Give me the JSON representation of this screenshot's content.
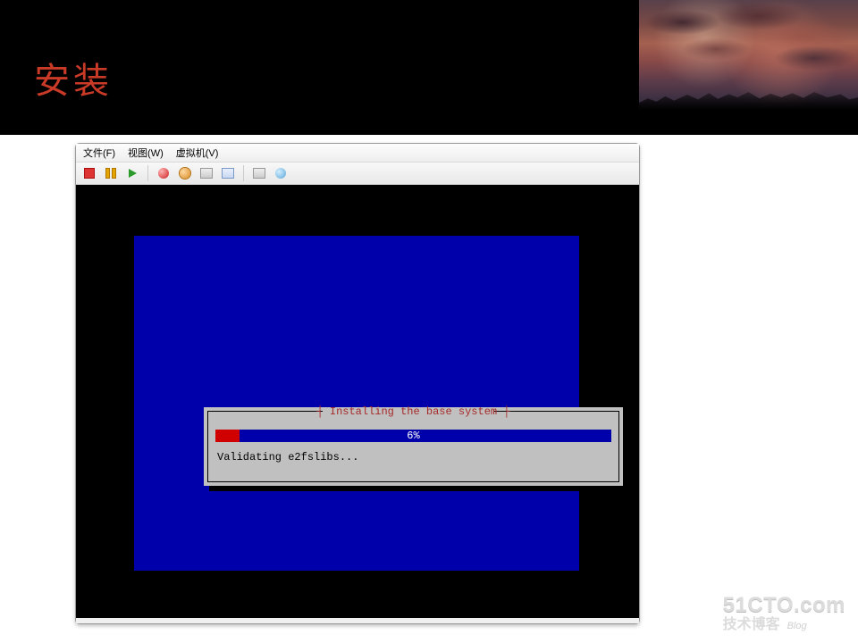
{
  "banner": {
    "title": "安装"
  },
  "vm": {
    "menus": {
      "file": "文件(F)",
      "view": "视图(W)",
      "machine": "虚拟机(V)"
    },
    "icons": {
      "stop": "stop-icon",
      "pause": "pause-icon",
      "play": "play-icon",
      "poweroff": "poweroff-icon",
      "snapshot": "snapshot-icon",
      "settings": "settings-icon",
      "fullscreen": "fullscreen-icon",
      "unity": "unity-icon",
      "disc": "disc-icon"
    }
  },
  "installer": {
    "title": "Installing the base system",
    "progress_percent": 6,
    "progress_label": "6%",
    "status": "Validating e2fslibs..."
  },
  "watermark": {
    "line1": "51CTO.com",
    "line2_main": "技术博客",
    "line2_sub": "Blog"
  },
  "colors": {
    "installer_blue": "#0000aa",
    "progress_fill": "#d00000",
    "title_color": "#a52a2a",
    "panel_gray": "#c0c0c0",
    "banner_title": "#c93a27"
  }
}
